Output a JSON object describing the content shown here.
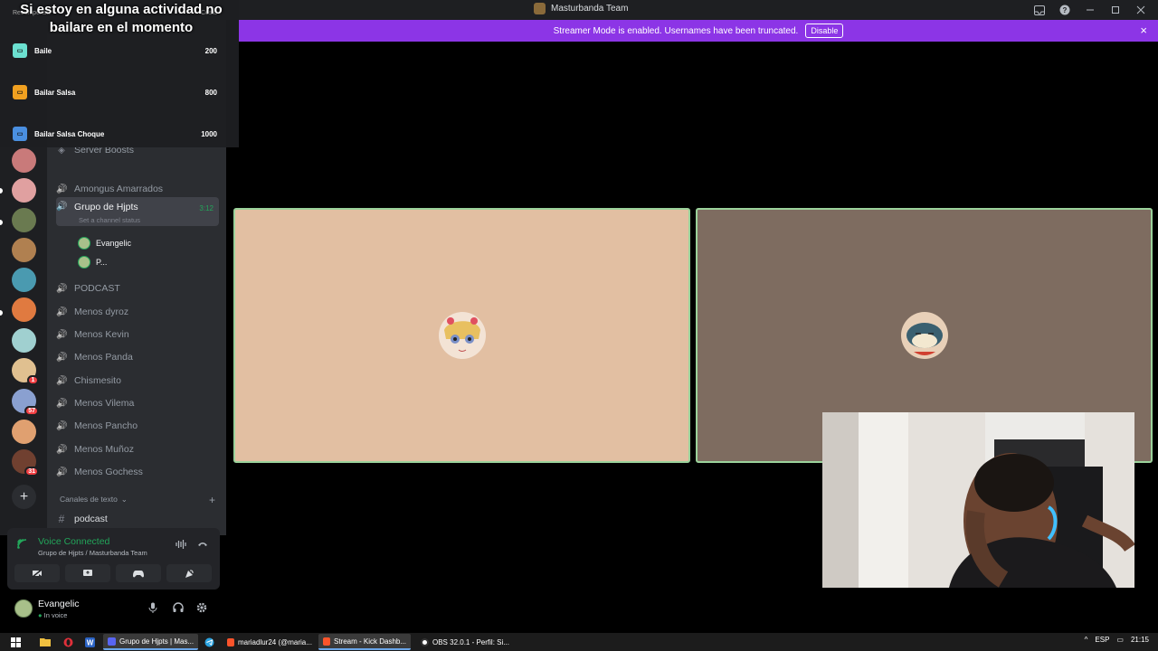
{
  "window": {
    "title": "Masturbanda Team",
    "controls": [
      "minimize",
      "maximize",
      "close"
    ]
  },
  "banner": {
    "text": "Streamer Mode is enabled. Usernames have been truncated.",
    "button": "Disable",
    "close": "×"
  },
  "overlay": {
    "title": "Si estoy en alguna actividad no bailare en el momento",
    "header_left": "Recompensa",
    "header_right": "Costo",
    "items": [
      {
        "label": "Baile",
        "cost": "200",
        "color": "#6be0d0"
      },
      {
        "label": "Bailar Salsa",
        "cost": "800",
        "color": "#f0a020"
      },
      {
        "label": "Bailar Salsa Choque",
        "cost": "1000",
        "color": "#4a8fe0"
      }
    ]
  },
  "servers": [
    {
      "name": "server-1",
      "color": "#c97a7a",
      "badge": ""
    },
    {
      "name": "server-2",
      "color": "#e0a0a0",
      "badge": ""
    },
    {
      "name": "server-3",
      "color": "#6a7a50",
      "badge": ""
    },
    {
      "name": "server-4",
      "color": "#b08050",
      "badge": ""
    },
    {
      "name": "server-5",
      "color": "#4a9ab0",
      "badge": ""
    },
    {
      "name": "server-6",
      "color": "#e07a40",
      "badge": ""
    },
    {
      "name": "server-7",
      "color": "#a0d0d0",
      "badge": ""
    },
    {
      "name": "server-8",
      "color": "#e0c090",
      "badge": "1"
    },
    {
      "name": "server-9",
      "color": "#8aa0d0",
      "badge": "57"
    },
    {
      "name": "server-10",
      "color": "#e0a070",
      "badge": ""
    },
    {
      "name": "server-11",
      "color": "#704030",
      "badge": "31"
    }
  ],
  "channels": {
    "boost": "Server Boosts",
    "voice": [
      "Amongus Amarrados",
      "Grupo de Hjpts",
      "PODCAST",
      "Menos dyroz",
      "Menos Kevin",
      "Menos Panda",
      "Chismesito",
      "Menos Vilema",
      "Menos Pancho",
      "Menos Muñoz",
      "Menos Gochess"
    ],
    "active_time": "3:12",
    "active_status": "Set a channel status",
    "members": [
      "Evangelic",
      "P..."
    ],
    "category": "Canales de texto",
    "text_channel": "podcast"
  },
  "voice_panel": {
    "title": "Voice Connected",
    "subtitle": "Grupo de Hjpts / Masturbanda Team"
  },
  "user": {
    "name": "Evangelic",
    "status": "In voice"
  },
  "tiles": [
    {
      "bg": "#e2bfa2"
    },
    {
      "bg": "#7e6c60"
    }
  ],
  "taskbar": {
    "tasks": [
      "Grupo de Hjpts | Mas...",
      "mariadlur24 (@maria...",
      "Stream - Kick Dashb...",
      "OBS 32.0.1 - Perfil: Si..."
    ],
    "lang": "ESP",
    "time": "21:15"
  }
}
